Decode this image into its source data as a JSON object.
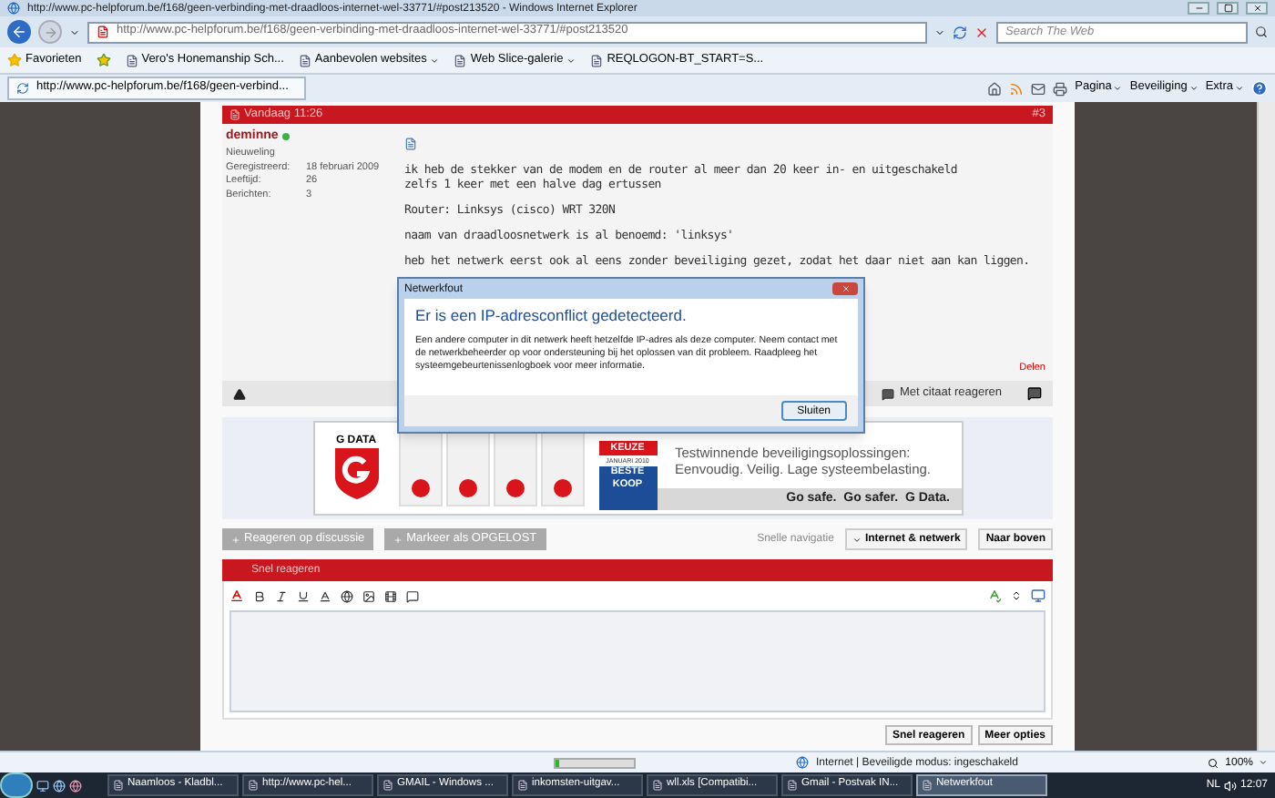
{
  "window": {
    "title": "http://www.pc-helpforum.be/f168/geen-verbinding-met-draadloos-internet-wel-33771/#post213520 - Windows Internet Explorer"
  },
  "address_bar": {
    "url": "http://www.pc-helpforum.be/f168/geen-verbinding-met-draadloos-internet-wel-33771/#post213520",
    "search_placeholder": "Search The Web"
  },
  "favorites_bar": {
    "label": "Favorieten",
    "items": [
      {
        "label": "Vero's Honemanship Sch...",
        "dropdown": false
      },
      {
        "label": "Aanbevolen websites",
        "dropdown": true
      },
      {
        "label": "Web Slice-galerie",
        "dropdown": true
      },
      {
        "label": "REQLOGON-BT_START=S...",
        "dropdown": false
      }
    ]
  },
  "tab": {
    "title": "http://www.pc-helpforum.be/f168/geen-verbind..."
  },
  "command_bar": [
    "Pagina",
    "Beveiliging",
    "Extra"
  ],
  "post": {
    "date": "Vandaag 11:26",
    "number": "#3",
    "user": {
      "name": "deminne",
      "online": true,
      "rank": "Nieuweling",
      "fields": [
        {
          "label": "Geregistreerd:",
          "value": "18 februari 2009"
        },
        {
          "label": "Leeftijd:",
          "value": "26"
        },
        {
          "label": "Berichten:",
          "value": "3"
        }
      ]
    },
    "paragraphs": [
      "ik heb de stekker van de modem en de router al meer dan 20 keer in- en uitgeschakeld\nzelfs 1 keer met een halve dag ertussen",
      "Router: Linksys (cisco) WRT 320N",
      "naam van draadloosnetwerk is al benoemd: 'linksys'",
      "heb het netwerk eerst ook al eens zonder beveiliging gezet, zodat het daar niet aan kan liggen."
    ],
    "share": "Delen",
    "quote_reply": "Met citaat reageren"
  },
  "ad": {
    "brand": "G DATA",
    "badge": [
      "KEUZE",
      "JANUARI 2010",
      "BESTE",
      "KOOP"
    ],
    "headline": "Testwinnende beveiligingsoplossingen:",
    "subline": "Eenvoudig. Veilig. Lage systeembelasting.",
    "slogan": "Go safe.  Go safer.  G Data."
  },
  "actions": [
    "Reageren op discussie",
    "Markeer als OPGELOST"
  ],
  "navigation": {
    "label": "Snelle navigatie",
    "forum": "Internet & netwerk",
    "top": "Naar boven"
  },
  "quick_reply": {
    "title": "Snel reageren",
    "buttons": [
      "Snel reageren",
      "Meer opties"
    ]
  },
  "dialog": {
    "title": "Netwerkfout",
    "heading": "Er is een IP-adresconflict gedetecteerd.",
    "message": "Een andere computer in dit netwerk heeft hetzelfde IP-adres als deze computer. Neem contact met de netwerkbeheerder op voor ondersteuning bij het oplossen van dit probleem. Raadpleeg het systeemgebeurtenissenlogboek voor meer informatie.",
    "button": "Sluiten"
  },
  "status_bar": {
    "level": 0.05,
    "zone": "Internet | Beveiligde modus: ingeschakeld",
    "zoom": "100%"
  },
  "taskbar": {
    "items": [
      {
        "label": "Naamloos - Kladbl...",
        "selected": false
      },
      {
        "label": "http://www.pc-hel...",
        "selected": false
      },
      {
        "label": "GMAIL - Windows ...",
        "selected": false
      },
      {
        "label": "inkomsten-uitgav...",
        "selected": false
      },
      {
        "label": "wll.xls  [Compatibi...",
        "selected": false
      },
      {
        "label": "Gmail - Postvak IN...",
        "selected": false
      },
      {
        "label": "Netwerkfout",
        "selected": true
      }
    ],
    "language": "NL",
    "time": "12:07"
  }
}
